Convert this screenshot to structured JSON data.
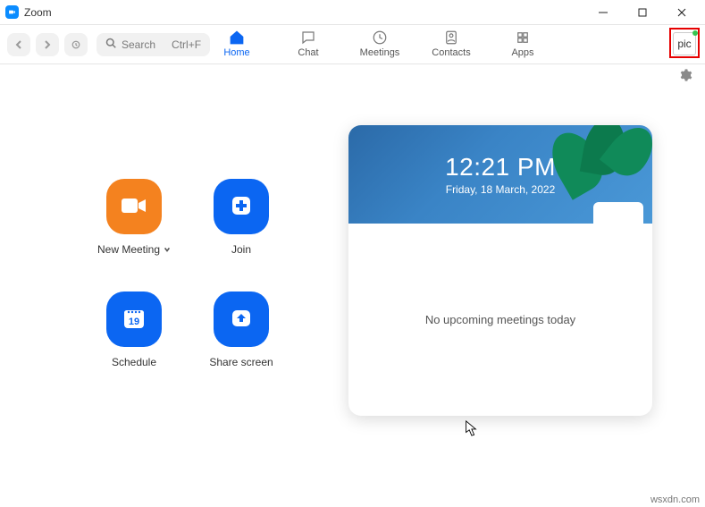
{
  "window": {
    "title": "Zoom"
  },
  "toolbar": {
    "search_placeholder": "Search",
    "search_shortcut": "Ctrl+F"
  },
  "tabs": {
    "home": "Home",
    "chat": "Chat",
    "meetings": "Meetings",
    "contacts": "Contacts",
    "apps": "Apps"
  },
  "profile": {
    "initials": "pic",
    "status": "online"
  },
  "actions": {
    "new_meeting": "New Meeting",
    "join": "Join",
    "schedule": "Schedule",
    "share_screen": "Share screen",
    "schedule_day": "19"
  },
  "clock": {
    "time": "12:21 PM",
    "date": "Friday, 18 March, 2022"
  },
  "meetings": {
    "empty_message": "No upcoming meetings today"
  },
  "watermark": "wsxdn.com"
}
